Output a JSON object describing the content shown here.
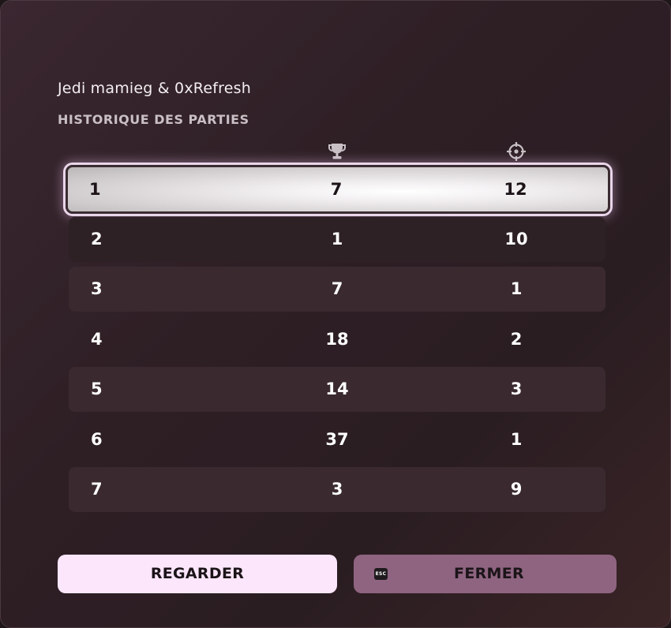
{
  "header": {
    "players": "Jedi mamieg & 0xRefresh",
    "title": "HISTORIQUE DES PARTIES"
  },
  "columns": {
    "icon_1": "trophy-icon",
    "icon_2": "crosshair-icon"
  },
  "rows": [
    {
      "game": "1",
      "score": "7",
      "eliminations": "12"
    },
    {
      "game": "2",
      "score": "1",
      "eliminations": "10"
    },
    {
      "game": "3",
      "score": "7",
      "eliminations": "1"
    },
    {
      "game": "4",
      "score": "18",
      "eliminations": "2"
    },
    {
      "game": "5",
      "score": "14",
      "eliminations": "3"
    },
    {
      "game": "6",
      "score": "37",
      "eliminations": "1"
    },
    {
      "game": "7",
      "score": "3",
      "eliminations": "9"
    }
  ],
  "selected_row": 1,
  "buttons": {
    "watch_label": "REGARDER",
    "close_label": "FERMER",
    "close_key": "ESC"
  },
  "colors": {
    "background": "#2e1f25",
    "row_alt": "#3a2a30",
    "primary_button": "#fce6fb",
    "secondary_button": "#8e6480"
  }
}
